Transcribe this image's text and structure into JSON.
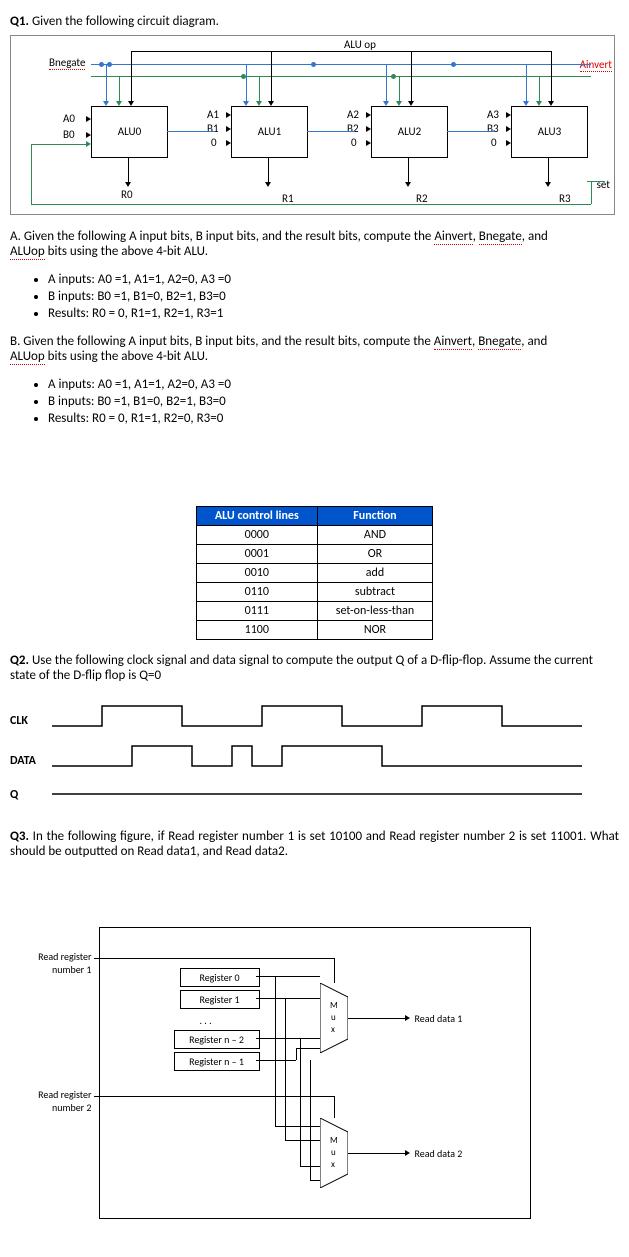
{
  "q1": {
    "title": "Q1.",
    "intro": "Given the following circuit diagram.",
    "labels": {
      "bnegate": "Bnegate",
      "ainvert": "Ainvert",
      "aluop": "ALU op",
      "set": "set",
      "alu0": "ALU0",
      "alu1": "ALU1",
      "alu2": "ALU2",
      "alu3": "ALU3",
      "a0": "A0",
      "b0": "B0",
      "a1": "A1",
      "b1": "B1",
      "z1": "0",
      "a2": "A2",
      "b2": "B2",
      "z2": "0",
      "a3": "A3",
      "b3": "B3",
      "z3": "0",
      "r0": "R0",
      "r1": "R1",
      "r2": "R2",
      "r3": "R3"
    },
    "partA": {
      "intro_pre": "A. Given the following A input bits, B input bits, and the result bits, compute the ",
      "ainvert": "Ainvert",
      "bnegate": "Bnegate",
      "aluop": "ALUop",
      "intro_post": " bits using the above 4-bit ALU.",
      "and": ", and ",
      "b1": "A inputs: A0 =1, A1=1, A2=0, A3 =0",
      "b2": "B inputs:  B0 =1, B1=0, B2=1, B3=0",
      "b3": "Results: R0 = 0, R1=1, R2=1, R3=1"
    },
    "partB": {
      "intro_pre": "B. Given the following A input bits, B input bits, and the result bits, compute the ",
      "ainvert": "Ainvert",
      "bnegate": "Bnegate",
      "aluop": "ALUop",
      "intro_post": " bits using the above 4-bit ALU.",
      "and": ", and ",
      "b1": "A inputs: A0 =1, A1=1, A2=0, A3 =0",
      "b2": "B inputs:  B0 =1, B1=0, B2=1, B3=0",
      "b3": "Results: R0 = 0, R1=1, R2=0, R3=0"
    }
  },
  "table": {
    "h1": "ALU control lines",
    "h2": "Function",
    "rows": [
      [
        "0000",
        "AND"
      ],
      [
        "0001",
        "OR"
      ],
      [
        "0010",
        "add"
      ],
      [
        "0110",
        "subtract"
      ],
      [
        "0111",
        "set-on-less-than"
      ],
      [
        "1100",
        "NOR"
      ]
    ]
  },
  "q2": {
    "title": "Q2.",
    "text": "Use the following clock signal and data signal to compute the output Q of a D-flip-flop. Assume the current state of the D-flip flop is Q=0",
    "clk": "CLK",
    "data": "DATA",
    "q": "Q"
  },
  "q3": {
    "title": "Q3.",
    "text": "In the following figure, if Read register number 1 is set 10100 and Read register number 2 is set 11001. What should be outputted on Read data1, and Read data2.",
    "rr1": "Read register number 1",
    "rr2": "Read register number 2",
    "reg0": "Register 0",
    "reg1": "Register 1",
    "dots": ". . .",
    "regn2": "Register n – 2",
    "regn1": "Register n – 1",
    "mux": "M\nu\nx",
    "rd1": "Read data 1",
    "rd2": "Read data 2"
  }
}
